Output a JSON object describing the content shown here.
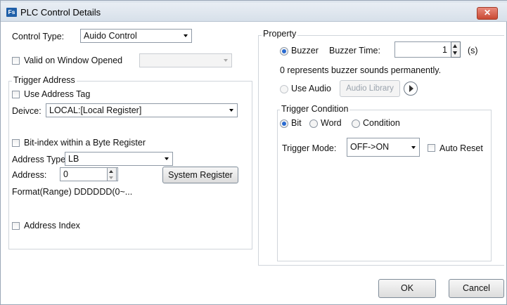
{
  "window": {
    "title": "PLC Control Details",
    "icon_text": "Fs",
    "close_glyph": "✕"
  },
  "left": {
    "control_type_label": "Control Type:",
    "control_type_value": "Auido Control",
    "valid_on_window_opened": "Valid on Window Opened",
    "trigger_address_title": "Trigger Address",
    "use_address_tag": "Use Address Tag",
    "device_label": "Deivce:",
    "device_value": "LOCAL:[Local Register]",
    "bit_index": "Bit-index within a Byte Register",
    "address_type_label": "Address Type:",
    "address_type_value": "LB",
    "address_label": "Address:",
    "address_value": "0",
    "system_register_button": "System Register",
    "format_range": "Format(Range) DDDDDD(0~...",
    "address_index": "Address Index"
  },
  "right": {
    "property_title": "Property",
    "buzzer_label": "Buzzer",
    "buzzer_time_label": "Buzzer Time:",
    "buzzer_time_value": "1",
    "buzzer_time_unit": "(s)",
    "buzzer_note": "0 represents buzzer sounds permanently.",
    "use_audio_label": "Use Audio",
    "audio_library_button": "Audio Library",
    "trigger_condition_title": "Trigger Condition",
    "bit_label": "Bit",
    "word_label": "Word",
    "condition_label": "Condition",
    "trigger_mode_label": "Trigger Mode:",
    "trigger_mode_value": "OFF->ON",
    "auto_reset_label": "Auto Reset"
  },
  "footer": {
    "ok_button": "OK",
    "cancel_button": "Cancel"
  },
  "colors": {
    "radio_selected": "#2a6bd1",
    "close_button": "#c94a34",
    "app_icon": "#1f5fa8"
  }
}
